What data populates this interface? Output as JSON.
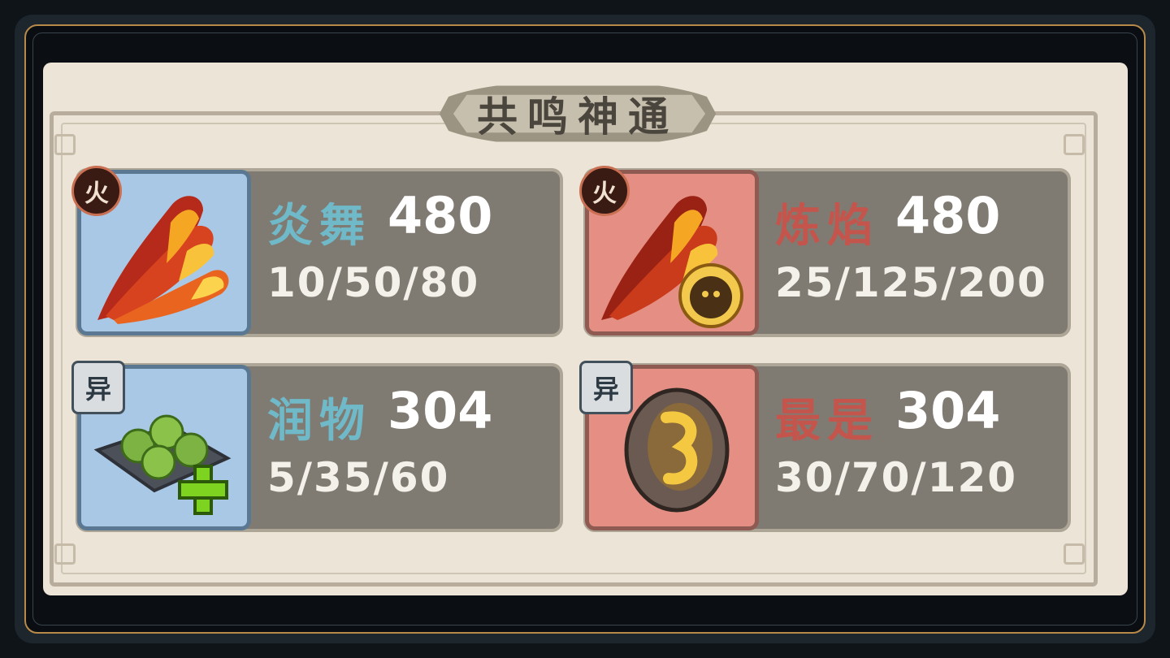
{
  "panel": {
    "title": "共鸣神通"
  },
  "cards": [
    {
      "name": "炎舞",
      "value": "480",
      "tiers": "10/50/80",
      "badge": "火",
      "theme": "blue",
      "icon": "fire-flames-icon"
    },
    {
      "name": "炼焰",
      "value": "480",
      "tiers": "25/125/200",
      "badge": "火",
      "theme": "red",
      "icon": "fire-flames-spirit-icon"
    },
    {
      "name": "润物",
      "value": "304",
      "tiers": "5/35/60",
      "badge": "异",
      "theme": "blue",
      "icon": "green-pills-heal-icon"
    },
    {
      "name": "最是",
      "value": "304",
      "tiers": "30/70/120",
      "badge": "异",
      "theme": "red",
      "icon": "stone-rune-icon"
    }
  ],
  "colors": {
    "blue_name": "#6fb9c9",
    "red_name": "#c4554d",
    "card_bg": "#807b72",
    "panel_bg": "#ece4d6"
  }
}
